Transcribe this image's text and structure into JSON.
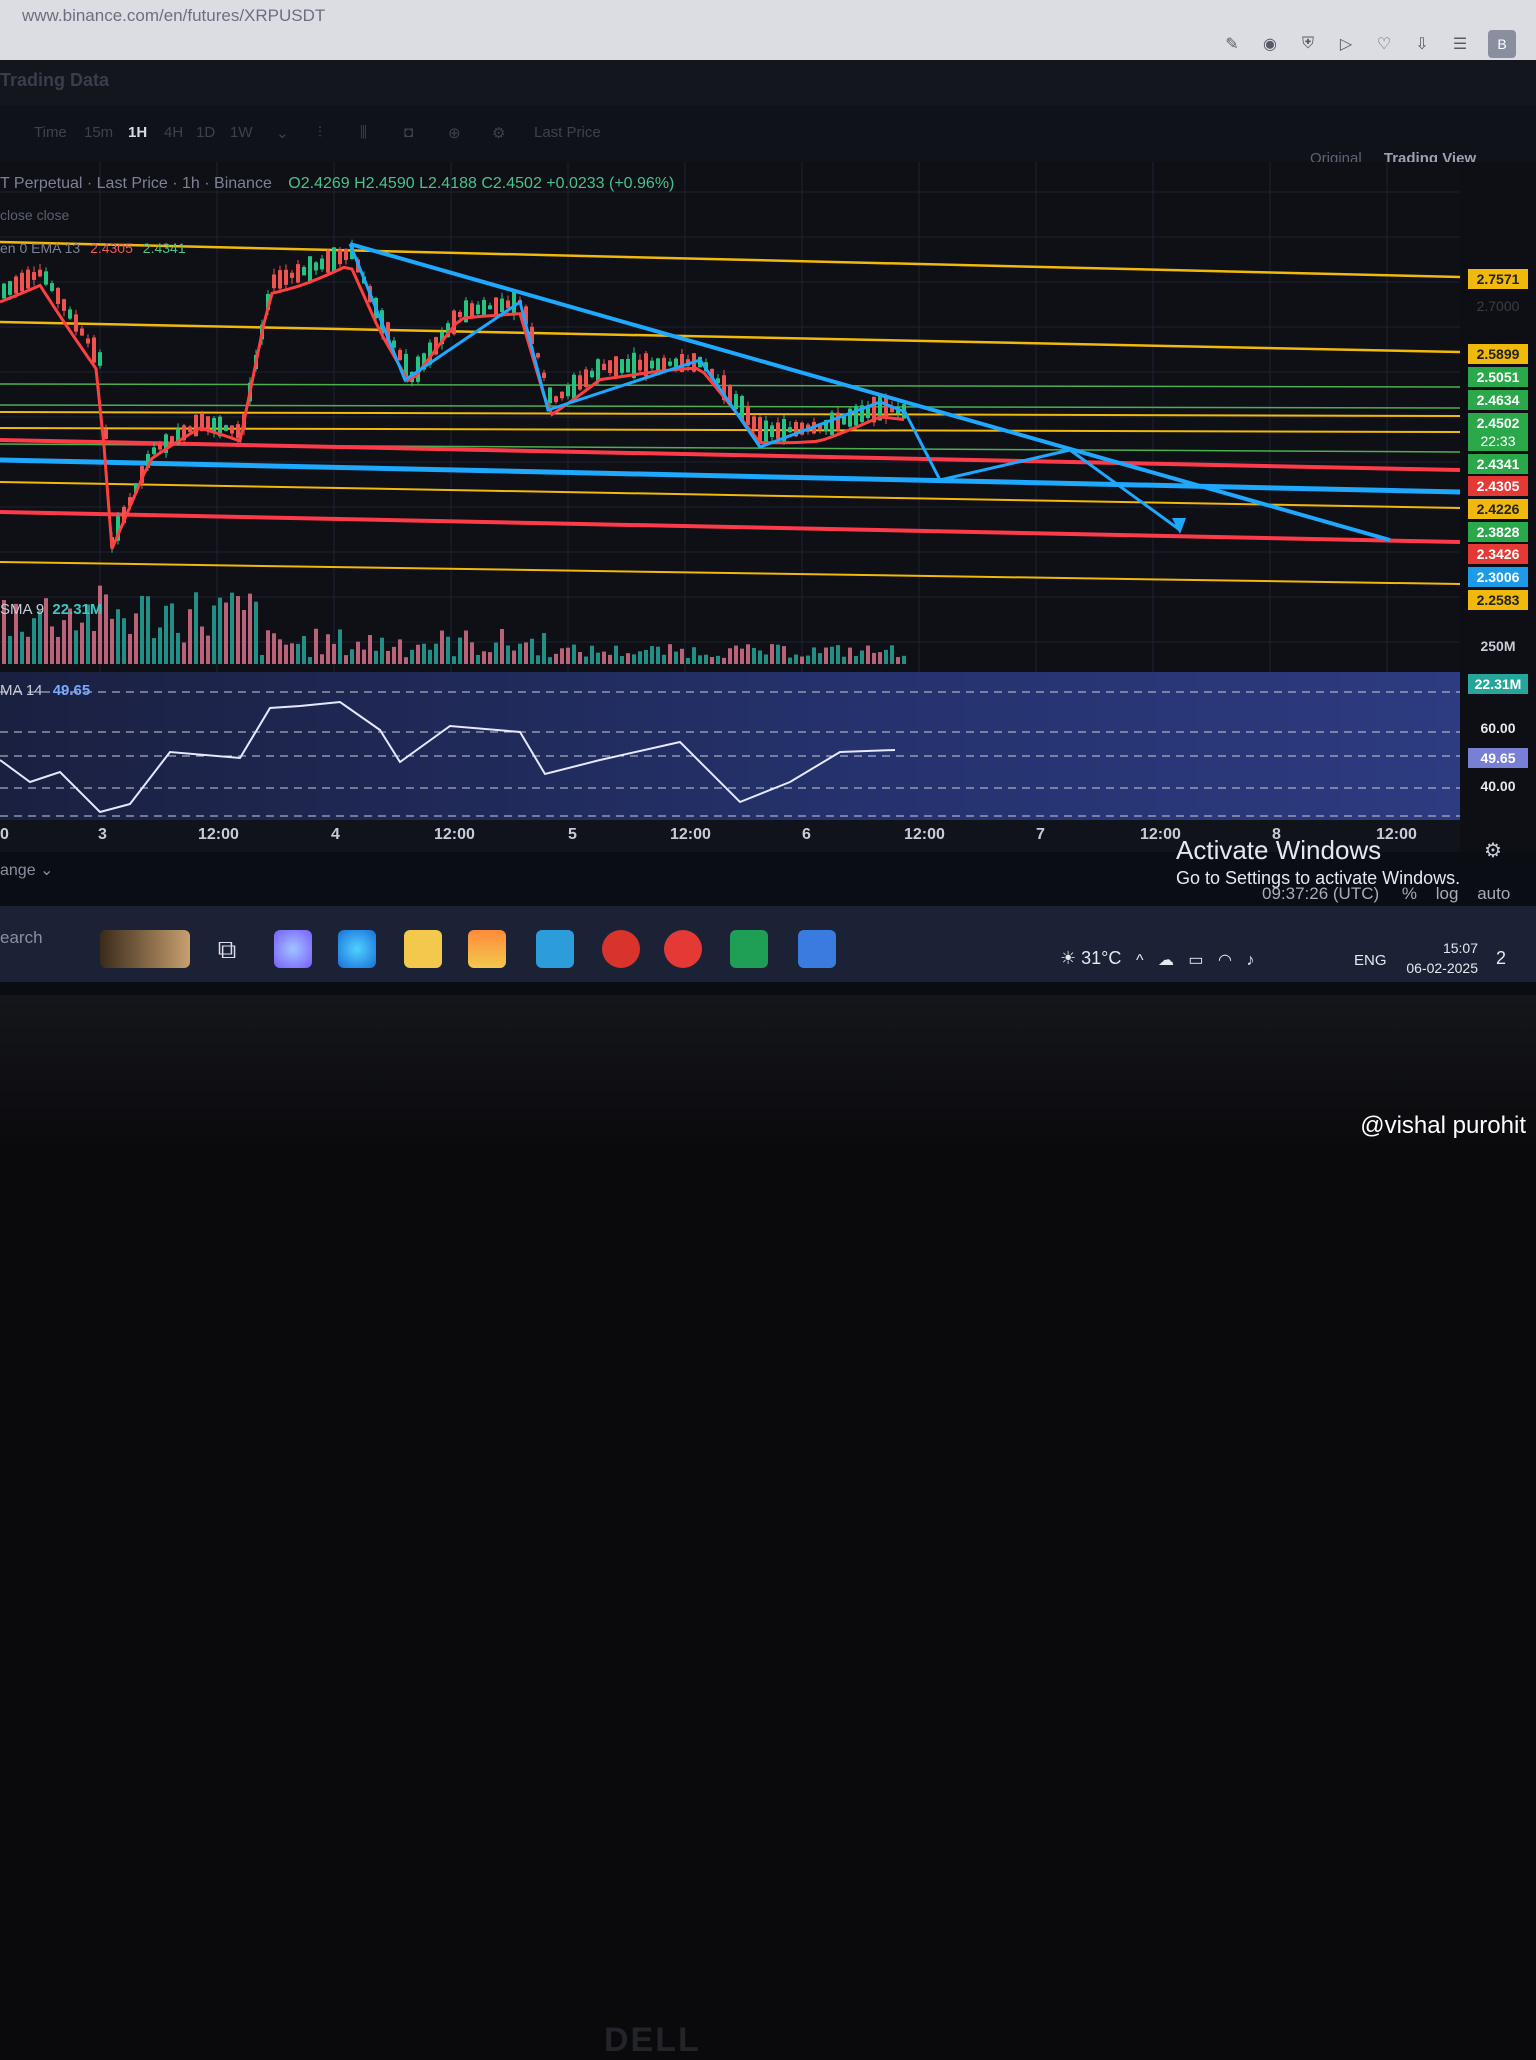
{
  "browser": {
    "url": "www.binance.com/en/futures/XRPUSDT",
    "profile_letter": "B"
  },
  "page": {
    "section_title": "Trading Data",
    "trading_view_tabs": [
      "Original",
      "Trading View"
    ]
  },
  "toolbar": {
    "time_label": "Time",
    "intervals": [
      "15m",
      "1H",
      "4H",
      "1D",
      "1W"
    ],
    "active_interval": "1H",
    "price_type": "Last Price"
  },
  "legend": {
    "line1": "T Perpetual · Last Price · 1h · Binance",
    "ohlc": "O2.4269  H2.4590  L2.4188  C2.4502  +0.0233 (+0.96%)",
    "line2": "close close",
    "ema_label": "en 0 EMA 13",
    "ema_val1": "2.4305",
    "ema_val2": "2.4341"
  },
  "price_axis": {
    "levels": [
      {
        "value": "2.7571",
        "color": "#f0b90b",
        "dark": true
      },
      {
        "value": "2.7000",
        "color": "none",
        "dark": false
      },
      {
        "value": "2.5899",
        "color": "#f0b90b",
        "dark": true
      },
      {
        "value": "2.5051",
        "color": "#2aa84a",
        "dark": false
      },
      {
        "value": "2.4634",
        "color": "#2aa84a",
        "dark": false
      },
      {
        "value": "2.4502",
        "color": "#2aa84a",
        "dark": false
      },
      {
        "value": "22:33",
        "color": "#2aa84a",
        "dark": false
      },
      {
        "value": "2.4341",
        "color": "#2aa84a",
        "dark": false
      },
      {
        "value": "2.4305",
        "color": "#e53935",
        "dark": false
      },
      {
        "value": "2.4226",
        "color": "#f0b90b",
        "dark": true
      },
      {
        "value": "2.3828",
        "color": "#2aa84a",
        "dark": false
      },
      {
        "value": "2.3426",
        "color": "#e53935",
        "dark": false
      },
      {
        "value": "2.3006",
        "color": "#1e9be8",
        "dark": false
      },
      {
        "value": "2.2583",
        "color": "#f0b90b",
        "dark": true
      }
    ],
    "volume_top": "250M",
    "volume_current": "22.31M",
    "rsi_upper": "60.00",
    "rsi_current": "49.65",
    "rsi_lower": "40.00"
  },
  "volume": {
    "label": "SMA 9",
    "value": "22.31M"
  },
  "rsi": {
    "label": "MA 14",
    "value": "49.65"
  },
  "time_axis": [
    "0",
    "3",
    "12:00",
    "4",
    "12:00",
    "5",
    "12:00",
    "6",
    "12:00",
    "7",
    "12:00",
    "8",
    "12:00"
  ],
  "bottom": {
    "range_label": "ange",
    "utc_time": "09:37:26 (UTC)",
    "pct": "%",
    "log": "log",
    "auto": "auto"
  },
  "windows": {
    "activate_title": "Activate Windows",
    "activate_sub": "Go to Settings to activate Windows.",
    "search_text": "earch",
    "temperature": "31°C",
    "language": "ENG",
    "time": "15:07",
    "date": "06-02-2025",
    "notifications": "2"
  },
  "laptop": {
    "brand": "DELL"
  },
  "watermark": "@vishal purohit",
  "colors": {
    "yellow_line": "#f0b90b",
    "green_line": "#4caf50",
    "red_line": "#ff3b4a",
    "blue_line": "#1ea8ff",
    "candle_up": "#26c281",
    "candle_down": "#ef5350"
  }
}
